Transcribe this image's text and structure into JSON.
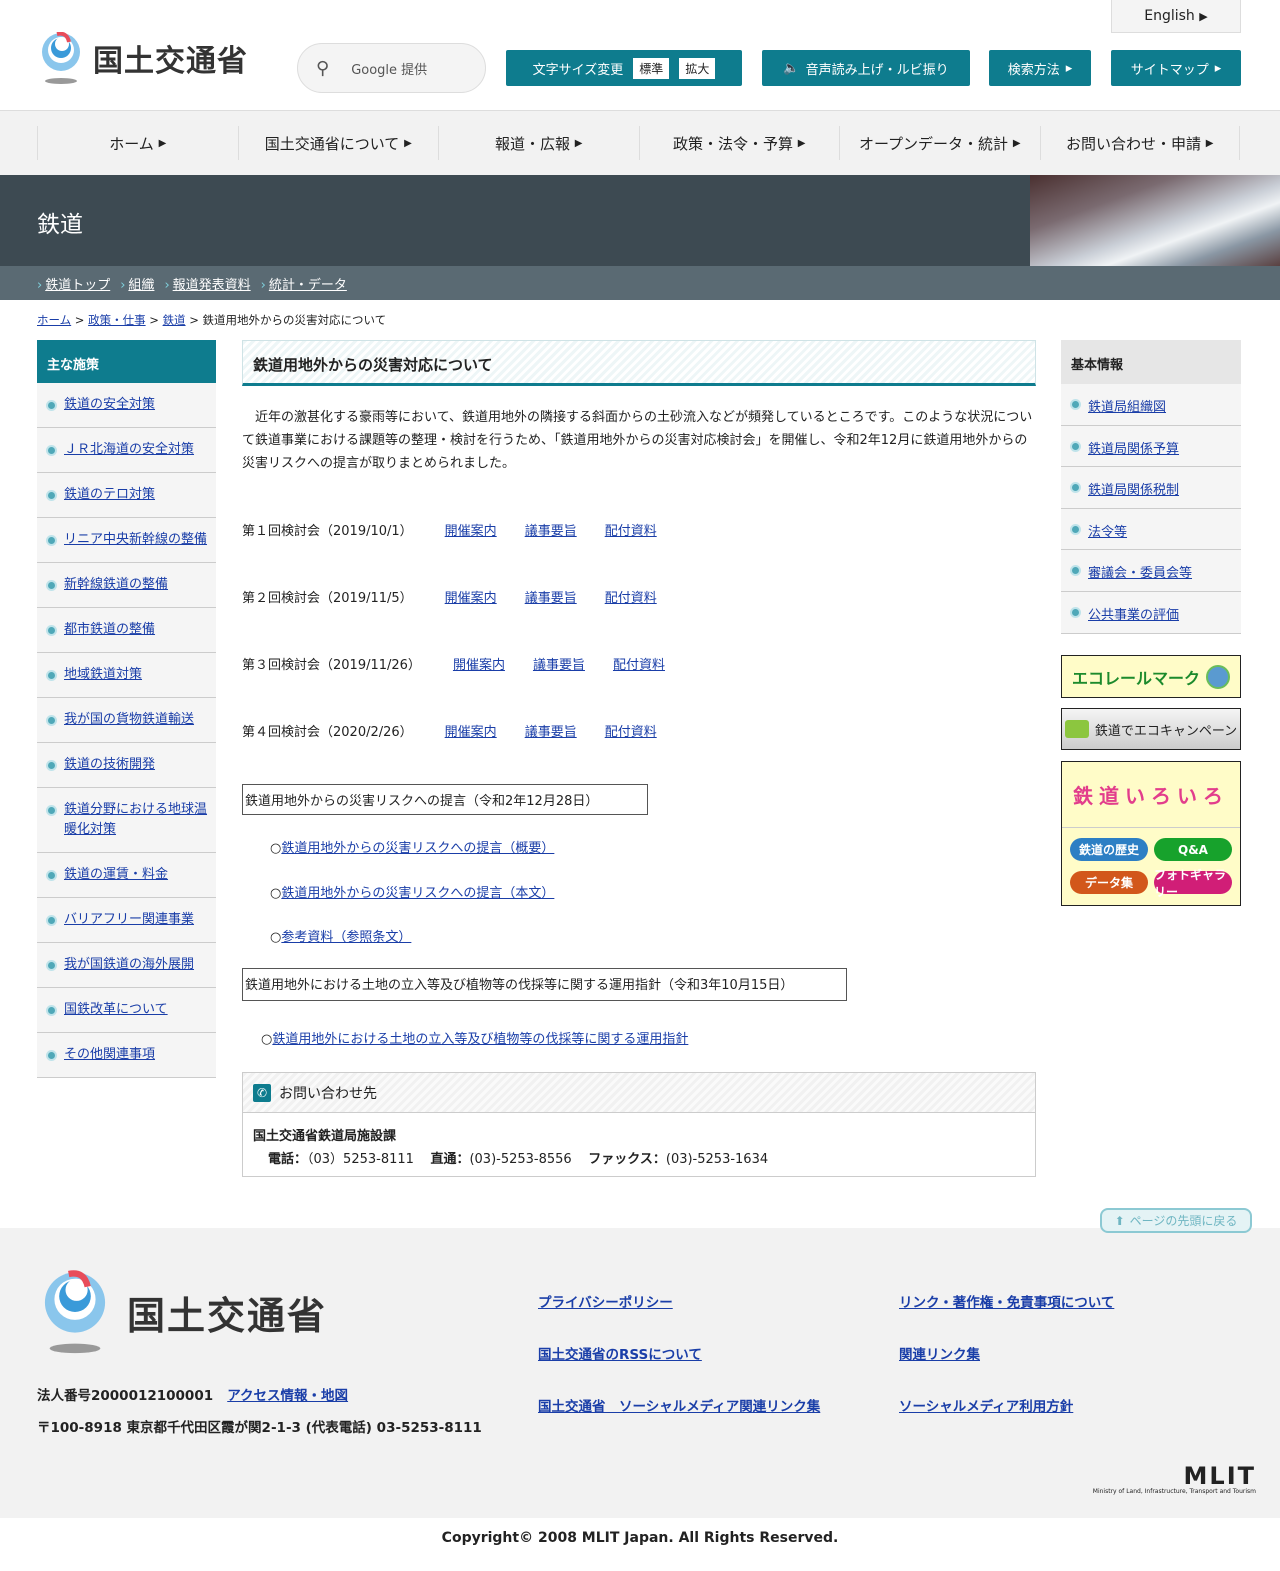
{
  "header": {
    "logo": "国土交通省",
    "search_placeholder": "Google 提供",
    "font_size_label": "文字サイズ変更",
    "font_standard": "標準",
    "font_large": "拡大",
    "speech": "音声読み上げ・ルビ振り",
    "search_method": "検索方法",
    "sitemap": "サイトマップ",
    "english": "English"
  },
  "nav": [
    "ホーム",
    "国土交通省について",
    "報道・広報",
    "政策・法令・予算",
    "オープンデータ・統計",
    "お問い合わせ・申請"
  ],
  "section": {
    "title": "鉄道",
    "subnav": [
      "鉄道トップ",
      "組織",
      "報道発表資料",
      "統計・データ"
    ]
  },
  "breadcrumb": {
    "items": [
      "ホーム",
      "政策・仕事",
      "鉄道"
    ],
    "current": "鉄道用地外からの災害対応について"
  },
  "left_sidebar": {
    "heading": "主な施策",
    "items": [
      "鉄道の安全対策",
      "ＪＲ北海道の安全対策",
      "鉄道のテロ対策",
      "リニア中央新幹線の整備",
      "新幹線鉄道の整備",
      "都市鉄道の整備",
      "地域鉄道対策",
      "我が国の貨物鉄道輸送",
      "鉄道の技術開発",
      "鉄道分野における地球温暖化対策",
      "鉄道の運賃・料金",
      "バリアフリー関連事業",
      "我が国鉄道の海外展開",
      "国鉄改革について",
      "その他関連事項"
    ]
  },
  "main": {
    "title": "鉄道用地外からの災害対応について",
    "intro": "近年の激甚化する豪雨等において、鉄道用地外の隣接する斜面からの土砂流入などが頻発しているところです。このような状況について鉄道事業における課題等の整理・検討を行うため、「鉄道用地外からの災害対応検討会」を開催し、令和2年12月に鉄道用地外からの災害リスクへの提言が取りまとめられました。",
    "meetings": [
      {
        "label": "第１回検討会（2019/10/1）",
        "links": [
          "開催案内",
          "議事要旨",
          "配付資料"
        ]
      },
      {
        "label": "第２回検討会（2019/11/5）",
        "links": [
          "開催案内",
          "議事要旨",
          "配付資料"
        ]
      },
      {
        "label": "第３回検討会（2019/11/26）",
        "links": [
          "開催案内",
          "議事要旨",
          "配付資料"
        ]
      },
      {
        "label": "第４回検討会（2020/2/26）",
        "links": [
          "開催案内",
          "議事要旨",
          "配付資料"
        ]
      }
    ],
    "proposal_box": "鉄道用地外からの災害リスクへの提言（令和2年12月28日）",
    "proposal_links": [
      "鉄道用地外からの災害リスクへの提言（概要）",
      "鉄道用地外からの災害リスクへの提言（本文）",
      "参考資料（参照条文）"
    ],
    "guideline_box": "鉄道用地外における土地の立入等及び植物等の伐採等に関する運用指針（令和3年10月15日）",
    "guideline_link": "鉄道用地外における土地の立入等及び植物等の伐採等に関する運用指針",
    "bullet": "○",
    "contact": {
      "heading": "お問い合わせ先",
      "org": "国土交通省鉄道局施設課",
      "tel_label": "電話：",
      "tel": "（03）5253-8111",
      "direct_label": "直通：",
      "direct": "(03)-5253-8556",
      "fax_label": "ファックス：",
      "fax": "(03)-5253-1634"
    }
  },
  "right_sidebar": {
    "heading": "基本情報",
    "items": [
      "鉄道局組織図",
      "鉄道局関係予算",
      "鉄道局関係税制",
      "法令等",
      "審議会・委員会等",
      "公共事業の評価"
    ],
    "banners": {
      "ecorail": "エコレールマーク",
      "eco_campaign": "鉄道でエコキャンペーン",
      "iroiro": "鉄道いろいろ",
      "history": "鉄道の歴史",
      "qa": "Q&A",
      "data": "データ集",
      "photo": "フォトギャラリー"
    }
  },
  "back_to_top": "ページの先頭に戻る",
  "footer": {
    "logo": "国土交通省",
    "corp_number": "法人番号2000012100001",
    "access": "アクセス情報・地図",
    "address": "〒100-8918 東京都千代田区霞が関2-1-3 (代表電話) 03-5253-8111",
    "links": [
      "プライバシーポリシー",
      "リンク・著作権・免責事項について",
      "国土交通省のRSSについて",
      "関連リンク集",
      "国土交通省　ソーシャルメディア関連リンク集",
      "ソーシャルメディア利用方針"
    ],
    "mlit": "MLIT",
    "mlit_sub": "Ministry of Land, Infrastructure, Transport and Tourism",
    "copyright": "Copyright© 2008 MLIT Japan. All Rights Reserved."
  },
  "colors": {
    "accent": "#0e7c8e",
    "band": "#3d4a52",
    "link": "#1a3ea8"
  }
}
